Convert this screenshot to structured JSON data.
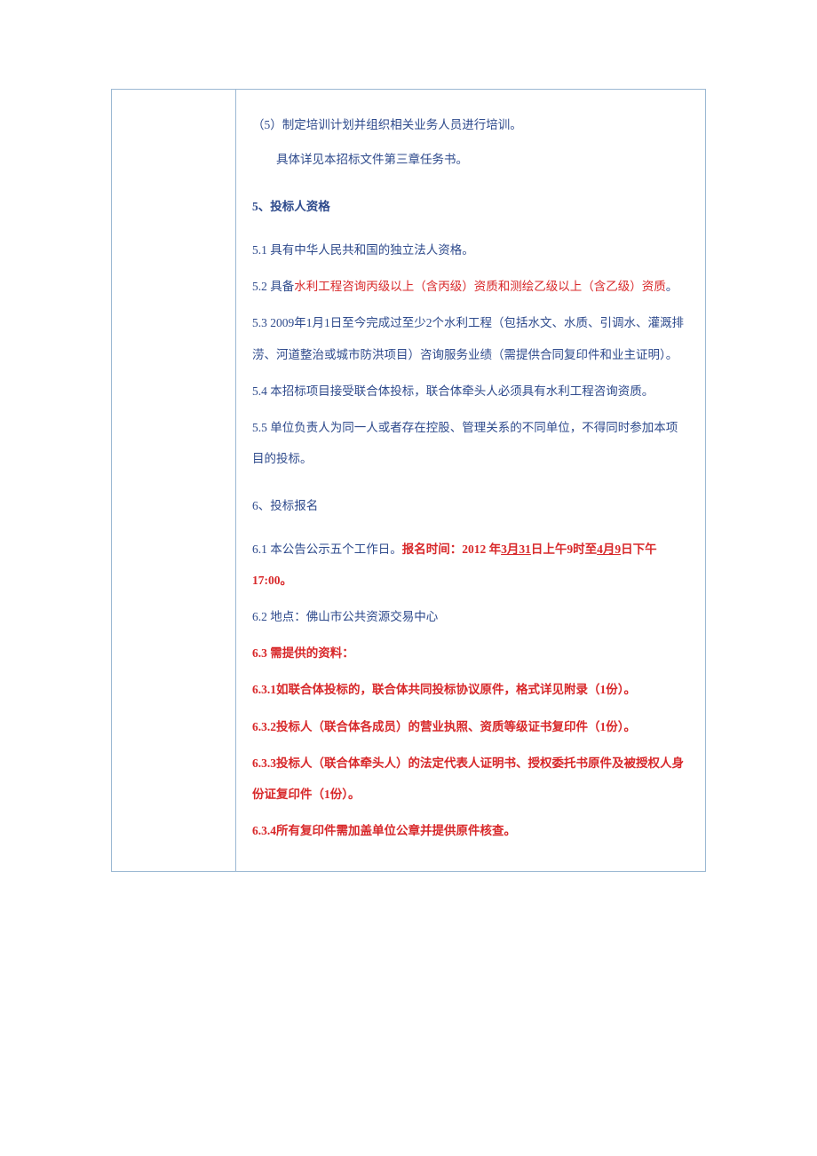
{
  "content": {
    "p1": "（5）制定培训计划并组织相关业务人员进行培训。",
    "p2": "具体详见本招标文件第三章任务书。",
    "h5": "5、投标人资格",
    "p5_1": "5.1 具有中华人民共和国的独立法人资格。",
    "p5_2_pre": "5.2 具备",
    "p5_2_red": "水利工程咨询丙级以上（含丙级）资质和测绘乙级以上（含乙级）资质",
    "p5_2_period": "。",
    "p5_3": "5.3 2009年1月1日至今完成过至少2个水利工程（包括水文、水质、引调水、灌溉排涝、河道整治或城市防洪项目）咨询服务业绩（需提供合同复印件和业主证明）。",
    "p5_4": "5.4 本招标项目接受联合体投标，联合体牵头人必须具有水利工程咨询资质。",
    "p5_5": "5.5 单位负责人为同一人或者存在控股、管理关系的不同单位，不得同时参加本项目的投标。",
    "h6": "6、投标报名",
    "p6_1_pre": "6.1 本公告公示五个工作日。",
    "p6_1_b1": "报名时间：2012 年",
    "p6_1_u1": "3月31",
    "p6_1_b2": "日上午9时至",
    "p6_1_u2": "4月9",
    "p6_1_b3": "日下午17:00。",
    "p6_2": "6.2 地点：佛山市公共资源交易中心",
    "p6_3": "6.3 需提供的资料：",
    "p6_3_1": "6.3.1如联合体投标的，联合体共同投标协议原件，格式详见附录（1份）。",
    "p6_3_2": "6.3.2投标人（联合体各成员）的营业执照、资质等级证书复印件（1份）。",
    "p6_3_3": "6.3.3投标人（联合体牵头人）的法定代表人证明书、授权委托书原件及被授权人身份证复印件（1份）。",
    "p6_3_4": "6.3.4所有复印件需加盖单位公章并提供原件核查。"
  }
}
